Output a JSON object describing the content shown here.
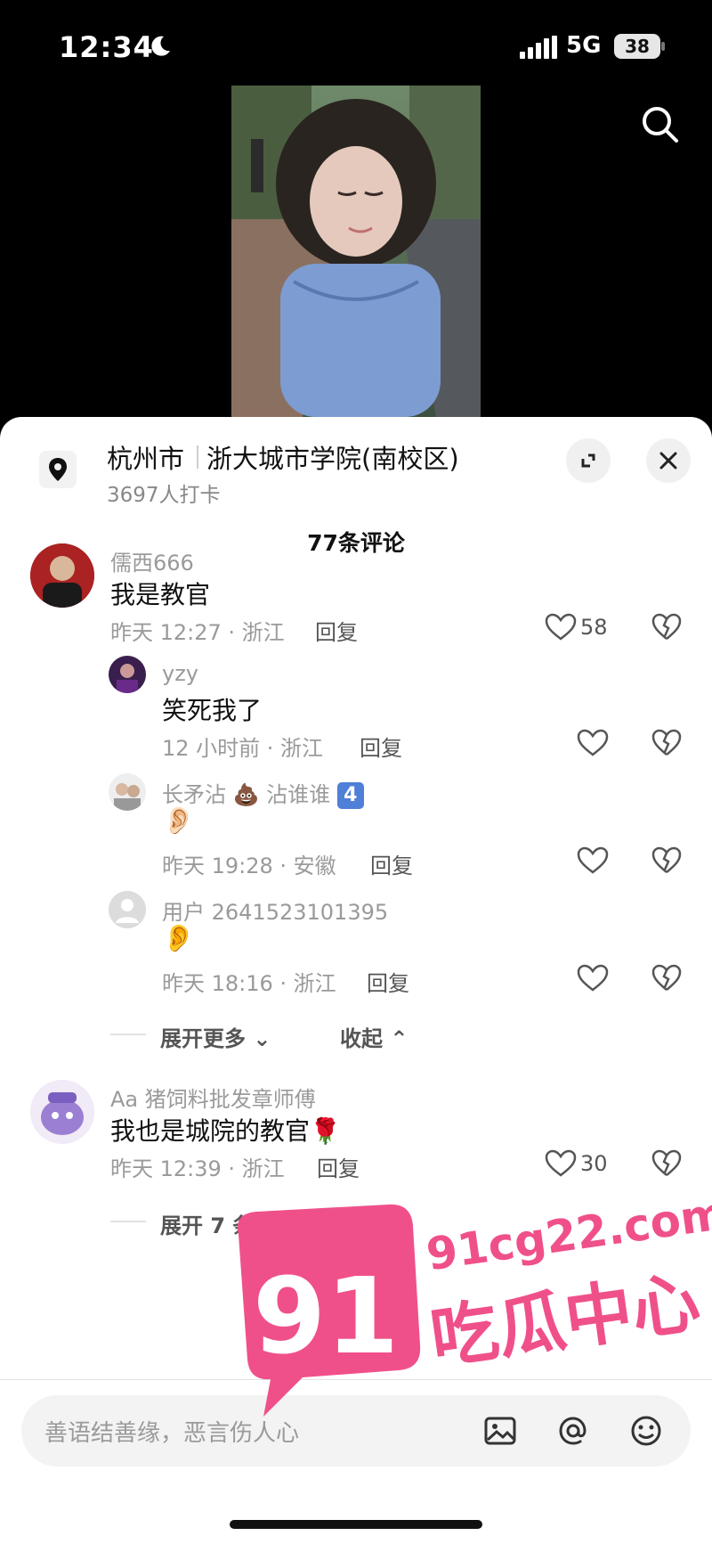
{
  "status": {
    "time": "12:34",
    "network": "5G",
    "battery": "38"
  },
  "location": {
    "city": "杭州市",
    "place": "浙大城市学院(南校区)",
    "checkins": "3697人打卡"
  },
  "comments_header": "77条评论",
  "comments": [
    {
      "name": "儒西666",
      "text": "我是教官",
      "meta": "昨天 12:27 · 浙江",
      "reply": "回复",
      "likes": "58"
    },
    {
      "name": "yzy",
      "text": "笑死我了",
      "meta": "12 小时前 · 浙江",
      "reply": "回复"
    },
    {
      "name_a": "长矛沾",
      "name_b": "沾谁谁",
      "name_badge": "4",
      "text": "👂🏻",
      "meta": "昨天 19:28 · 安徽",
      "reply": "回复"
    },
    {
      "name": "用户 2641523101395",
      "text": "👂",
      "meta": "昨天 18:16 · 浙江",
      "reply": "回复"
    },
    {
      "name": "Aa 猪饲料批发章师傅",
      "text": "我也是城院的教官",
      "meta": "昨天 12:39 · 浙江",
      "reply": "回复",
      "likes": "30"
    }
  ],
  "replies_controls": {
    "expand_more": "展开更多",
    "collapse": "收起"
  },
  "expand_replies": "展开 7 条回复",
  "input": {
    "placeholder": "善语结善缘，恶言伤人心"
  },
  "watermark": {
    "number": "91",
    "url": "91cg22.com",
    "name": "吃瓜中心"
  },
  "colors": {
    "watermark": "#f0508a",
    "sheet_bg": "#ffffff"
  }
}
